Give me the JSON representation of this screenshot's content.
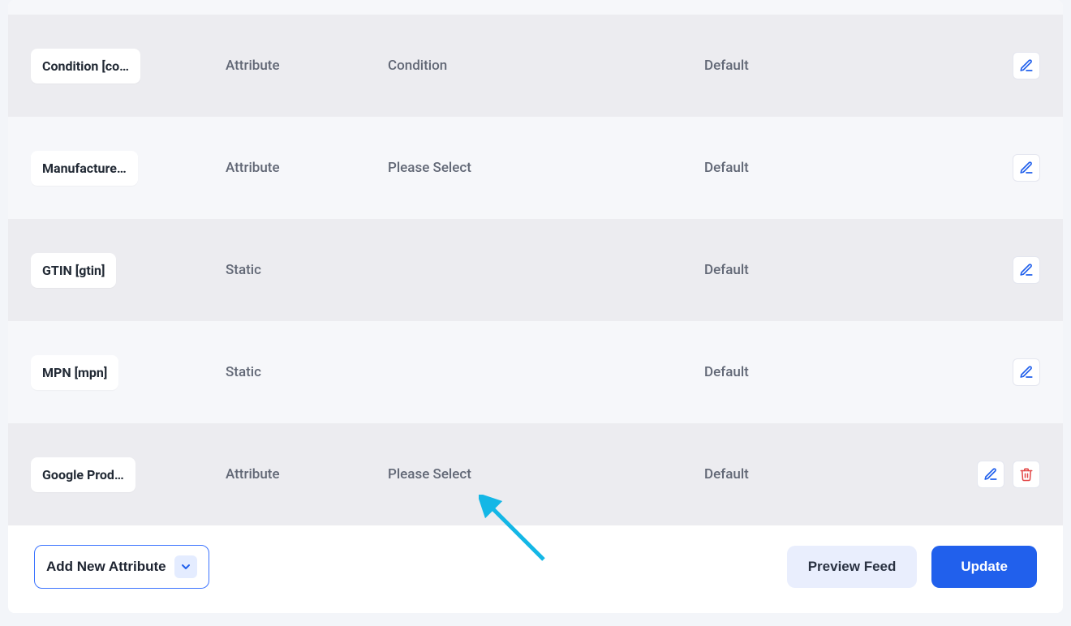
{
  "rows": [
    {
      "name": "Condition [co…",
      "type": "Attribute",
      "value": "Condition",
      "scope": "Default",
      "deletable": false
    },
    {
      "name": "Manufacture…",
      "type": "Attribute",
      "value": "Please Select",
      "scope": "Default",
      "deletable": false
    },
    {
      "name": "GTIN [gtin]",
      "type": "Static",
      "value": "",
      "scope": "Default",
      "deletable": false
    },
    {
      "name": "MPN [mpn]",
      "type": "Static",
      "value": "",
      "scope": "Default",
      "deletable": false
    },
    {
      "name": "Google Prod…",
      "type": "Attribute",
      "value": "Please Select",
      "scope": "Default",
      "deletable": true
    }
  ],
  "footer": {
    "add_label": "Add New Attribute",
    "preview_label": "Preview Feed",
    "update_label": "Update"
  },
  "colors": {
    "accent": "#2160ec",
    "danger": "#e24646",
    "annotation": "#14b7e6"
  }
}
